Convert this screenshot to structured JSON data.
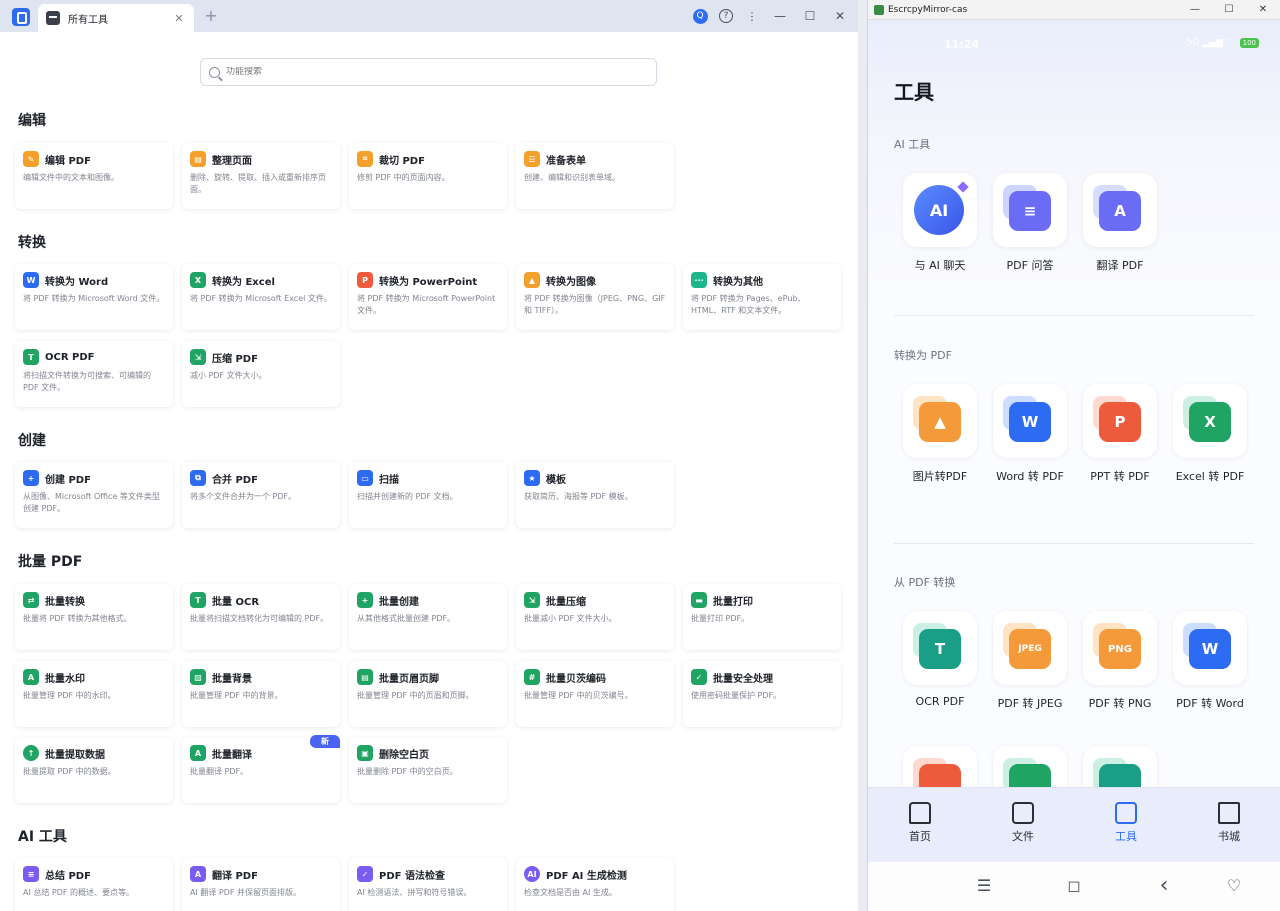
{
  "desktop": {
    "tab_label": "所有工具",
    "tab_close": "✕",
    "new_tab": "+",
    "avatar_letter": "Q",
    "help": "?",
    "more": "⋮",
    "minimize": "—",
    "maximize": "☐",
    "close": "✕",
    "search_placeholder": "功能搜索",
    "sections": {
      "edit": "编辑",
      "convert": "转换",
      "create": "创建",
      "batch": "批量 PDF",
      "ai": "AI 工具"
    },
    "cards": {
      "edit_pdf": {
        "title": "编辑 PDF",
        "desc": "编辑文件中的文本和图像。",
        "color": "#f4a02a"
      },
      "organize_pages": {
        "title": "整理页面",
        "desc": "删除、旋转、提取、插入或重新排序页面。",
        "color": "#f4a02a"
      },
      "crop_pdf": {
        "title": "裁切 PDF",
        "desc": "修剪 PDF 中的页面内容。",
        "color": "#f4a02a"
      },
      "prepare_form": {
        "title": "准备表单",
        "desc": "创建、编辑和识别表单域。",
        "color": "#f4a02a"
      },
      "to_word": {
        "title": "转换为 Word",
        "desc": "将 PDF 转换为 Microsoft Word 文件。",
        "color": "#2c6bf2"
      },
      "to_excel": {
        "title": "转换为 Excel",
        "desc": "将 PDF 转换为 Microsoft Excel 文件。",
        "color": "#1fa463"
      },
      "to_ppt": {
        "title": "转换为 PowerPoint",
        "desc": "将 PDF 转换为 Microsoft PowerPoint 文件。",
        "color": "#ee5a3c"
      },
      "to_image": {
        "title": "转换为图像",
        "desc": "将 PDF 转换为图像（JPEG、PNG、GIF 和 TIFF）。",
        "color": "#f4a02a"
      },
      "to_other": {
        "title": "转换为其他",
        "desc": "将 PDF 转换为 Pages、ePub、HTML、RTF 和文本文件。",
        "color": "#1fb58a"
      },
      "ocr_pdf": {
        "title": "OCR PDF",
        "desc": "将扫描文件转换为可搜索、可编辑的 PDF 文件。",
        "color": "#1fa463"
      },
      "compress_pdf": {
        "title": "压缩 PDF",
        "desc": "减小 PDF 文件大小。",
        "color": "#1fa463"
      },
      "create_pdf": {
        "title": "创建 PDF",
        "desc": "从图像、Microsoft Office 等文件类型创建 PDF。",
        "color": "#2c6bf2"
      },
      "merge_pdf": {
        "title": "合并 PDF",
        "desc": "将多个文件合并为一个 PDF。",
        "color": "#2c6bf2"
      },
      "scan": {
        "title": "扫描",
        "desc": "扫描并创建新的 PDF 文档。",
        "color": "#2c6bf2"
      },
      "template": {
        "title": "模板",
        "desc": "获取简历、海报等 PDF 模板。",
        "color": "#2c6bf2"
      },
      "batch_convert": {
        "title": "批量转换",
        "desc": "批量将 PDF 转换为其他格式。",
        "color": "#1fa463"
      },
      "batch_ocr": {
        "title": "批量 OCR",
        "desc": "批量将扫描文档转化为可编辑的 PDF。",
        "color": "#1fa463"
      },
      "batch_create": {
        "title": "批量创建",
        "desc": "从其他格式批量创建 PDF。",
        "color": "#1fa463"
      },
      "batch_compress": {
        "title": "批量压缩",
        "desc": "批量减小 PDF 文件大小。",
        "color": "#1fa463"
      },
      "batch_print": {
        "title": "批量打印",
        "desc": "批量打印 PDF。",
        "color": "#1fa463"
      },
      "batch_watermark": {
        "title": "批量水印",
        "desc": "批量管理 PDF 中的水印。",
        "color": "#1fa463"
      },
      "batch_background": {
        "title": "批量背景",
        "desc": "批量管理 PDF 中的背景。",
        "color": "#1fa463"
      },
      "batch_header": {
        "title": "批量页眉页脚",
        "desc": "批量管理 PDF 中的页眉和页脚。",
        "color": "#1fa463"
      },
      "batch_bates": {
        "title": "批量贝茨编码",
        "desc": "批量管理 PDF 中的贝茨编号。",
        "color": "#1fa463"
      },
      "batch_secure": {
        "title": "批量安全处理",
        "desc": "使用密码批量保护 PDF。",
        "color": "#1fa463"
      },
      "batch_extract": {
        "title": "批量提取数据",
        "desc": "批量提取 PDF 中的数据。",
        "color": "#1fa463"
      },
      "batch_translate": {
        "title": "批量翻译",
        "desc": "批量翻译 PDF。",
        "color": "#1fa463"
      },
      "delete_blank": {
        "title": "删除空白页",
        "desc": "批量删除 PDF 中的空白页。",
        "color": "#1fa463"
      },
      "summarize_pdf": {
        "title": "总结 PDF",
        "desc": "AI 总结 PDF 的概述、要点等。",
        "color": "#7a5cf2"
      },
      "translate_pdf": {
        "title": "翻译 PDF",
        "desc": "AI 翻译 PDF 并保留页面排版。",
        "color": "#7a5cf2"
      },
      "grammar_check": {
        "title": "PDF 语法检查",
        "desc": "AI 检测语法、拼写和符号错误。",
        "color": "#7a5cf2"
      },
      "ai_detect": {
        "title": "PDF AI 生成检测",
        "desc": "检查文档是否由 AI 生成。",
        "color": "#7a5cf2"
      }
    },
    "badge_new": "新"
  },
  "mirror": {
    "window_title": "EscrcpyMirror-cas",
    "minimize": "—",
    "maximize": "☐",
    "close": "✕",
    "status_time": "11:24",
    "status_signal": "5G ▂▄▆ ◠",
    "status_battery": "100",
    "page_title": "工具",
    "sections": {
      "ai_tools": "AI 工具",
      "to_pdf": "转换为 PDF",
      "from_pdf": "从 PDF 转换"
    },
    "tiles": {
      "ai_chat": {
        "label": "与 AI 聊天",
        "icon": "AI"
      },
      "pdf_qa": {
        "label": "PDF 问答"
      },
      "translate_pdf": {
        "label": "翻译 PDF",
        "icon": "A"
      },
      "image_to_pdf": {
        "label": "图片转PDF"
      },
      "word_to_pdf": {
        "label": "Word 转 PDF",
        "icon": "W"
      },
      "ppt_to_pdf": {
        "label": "PPT 转 PDF",
        "icon": "P"
      },
      "excel_to_pdf": {
        "label": "Excel 转 PDF",
        "icon": "X"
      },
      "ocr_pdf": {
        "label": "OCR PDF",
        "icon": "T"
      },
      "pdf_to_jpeg": {
        "label": "PDF 转 JPEG",
        "icon": "JPEG"
      },
      "pdf_to_png": {
        "label": "PDF 转 PNG",
        "icon": "PNG"
      },
      "pdf_to_word": {
        "label": "PDF 转 Word",
        "icon": "W"
      }
    },
    "tabbar": {
      "home": "首页",
      "files": "文件",
      "tools": "工具",
      "bookshelf": "书城"
    },
    "nav": {
      "menu": "☰",
      "home": "◻",
      "back": "‹",
      "assist": "♡"
    }
  },
  "colors": {
    "accent": "#2c6bf2",
    "green": "#1fa463",
    "orange": "#f4a02a",
    "purple": "#7a5cf2"
  }
}
